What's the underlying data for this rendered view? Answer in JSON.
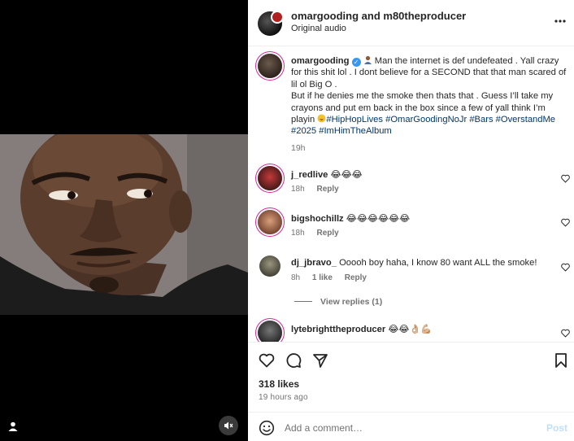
{
  "header": {
    "names": "omargooding and m80theproducer",
    "audio": "Original audio"
  },
  "caption": {
    "username": "omargooding",
    "text_1": " Man the internet is def undefeated . Yall crazy for this shit lol . I dont believe for a SECOND that that man scared of lil ol Big O .",
    "text_2": "But if he denies me the smoke then thats that . Guess I’ll take my crayons and put em back in the box since a few of yall think I’m playin ",
    "hashtags": "#HipHopLives #OmarGoodingNoJr #Bars #OverstandMe #2025 #ImHimTheAlbum",
    "time": "19h"
  },
  "comments": [
    {
      "username": "j_redlive",
      "text": "😂😂😂",
      "time": "18h",
      "reply": "Reply"
    },
    {
      "username": "bigshochillz",
      "text": "😂😂😂😂😂😂",
      "time": "18h",
      "reply": "Reply"
    },
    {
      "username": "dj_jbravo_",
      "text": "Ooooh boy haha, I know 80 want ALL the smoke!",
      "time": "8h",
      "likes": "1 like",
      "reply": "Reply"
    },
    {
      "username": "lytebrighttheproducer",
      "text": "😂😂👌🏼💪🏼"
    }
  ],
  "view_replies": "View replies (1)",
  "likes": "318 likes",
  "post_time": "19 hours ago",
  "add_comment": {
    "placeholder": "Add a comment…",
    "post_label": "Post"
  },
  "colors": {
    "hashtag": "#00376b",
    "verified": "#3897f0",
    "post_button_disabled": "#c0dffd",
    "muted_text": "#737373"
  },
  "icons": [
    "more-icon",
    "verified-icon",
    "heart-icon",
    "comment-icon",
    "share-icon",
    "bookmark-icon",
    "smile-icon",
    "user-icon",
    "mute-icon"
  ]
}
